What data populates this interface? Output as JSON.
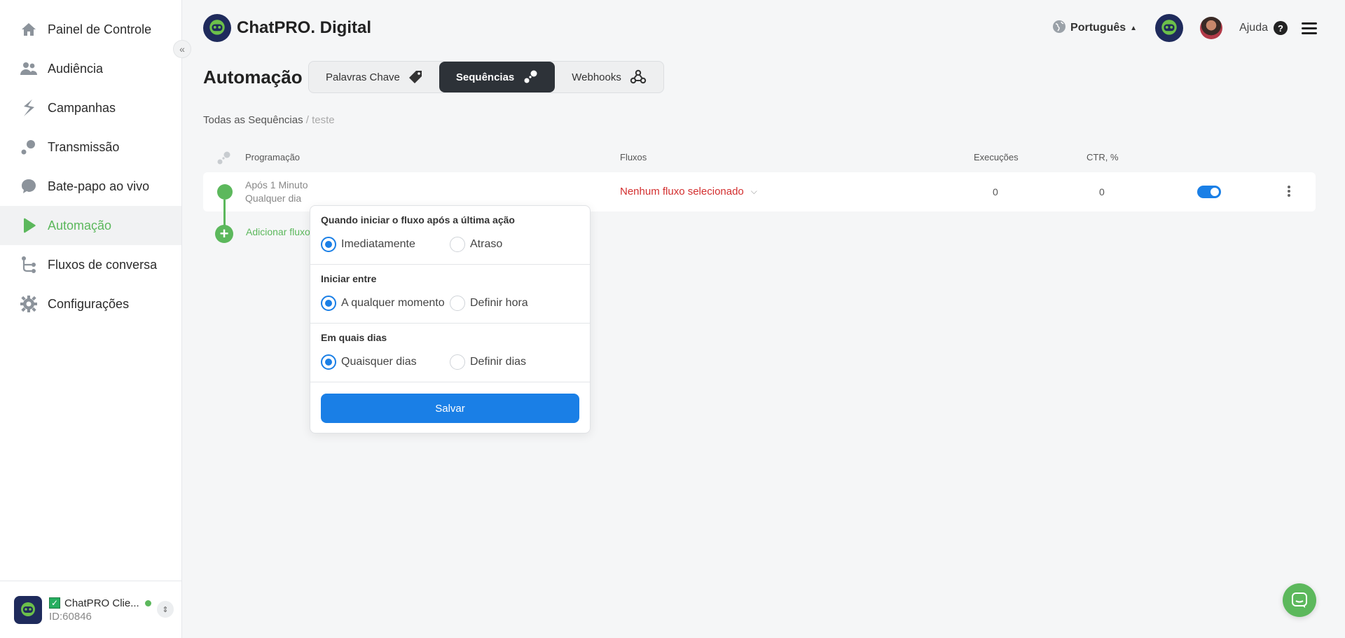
{
  "sidebar": {
    "items": [
      {
        "label": "Painel de Controle",
        "icon": "home-icon"
      },
      {
        "label": "Audiência",
        "icon": "users-icon"
      },
      {
        "label": "Campanhas",
        "icon": "bolt-icon"
      },
      {
        "label": "Transmissão",
        "icon": "broadcast-icon"
      },
      {
        "label": "Bate-papo ao vivo",
        "icon": "chat-icon"
      },
      {
        "label": "Automação",
        "icon": "play-icon",
        "active": true
      },
      {
        "label": "Fluxos de conversa",
        "icon": "flow-icon"
      },
      {
        "label": "Configurações",
        "icon": "gear-icon"
      }
    ],
    "collapse_symbol": "«",
    "account": {
      "name": "ChatPRO Clie...",
      "id": "ID:60846"
    }
  },
  "header": {
    "brand": "ChatPRO. Digital",
    "language": "Português",
    "help": "Ajuda",
    "help_symbol": "?"
  },
  "page": {
    "title": "Automação",
    "tabs": [
      {
        "label": "Palavras Chave",
        "icon": "tag-icon"
      },
      {
        "label": "Sequências",
        "icon": "sequence-icon",
        "active": true
      },
      {
        "label": "Webhooks",
        "icon": "webhook-icon"
      }
    ],
    "breadcrumb": {
      "root": "Todas as Sequências",
      "separator": " / ",
      "current": "teste"
    }
  },
  "table": {
    "columns": {
      "schedule": "Programação",
      "flows": "Fluxos",
      "executions": "Execuções",
      "ctr": "CTR, %"
    },
    "rows": [
      {
        "schedule_line1": "Após 1 Minuto",
        "schedule_line2": "Qualquer dia",
        "flow": "Nenhum fluxo selecionado",
        "executions": "0",
        "ctr": "0",
        "enabled": true
      }
    ],
    "add_label": "Adicionar fluxo",
    "add_symbol": "+"
  },
  "popover": {
    "section1": {
      "title": "Quando iniciar o fluxo após a última ação",
      "options": [
        "Imediatamente",
        "Atraso"
      ],
      "selected": "Imediatamente"
    },
    "section2": {
      "title": "Iniciar entre",
      "options": [
        "A qualquer momento",
        "Definir hora"
      ],
      "selected": "A qualquer momento"
    },
    "section3": {
      "title": "Em quais dias",
      "options": [
        "Quaisquer dias",
        "Definir dias"
      ],
      "selected": "Quaisquer dias"
    },
    "save_label": "Salvar"
  },
  "colors": {
    "accent": "#1a7fe6",
    "green": "#5cb85c",
    "dark": "#2d3238",
    "danger": "#d32f2f"
  }
}
